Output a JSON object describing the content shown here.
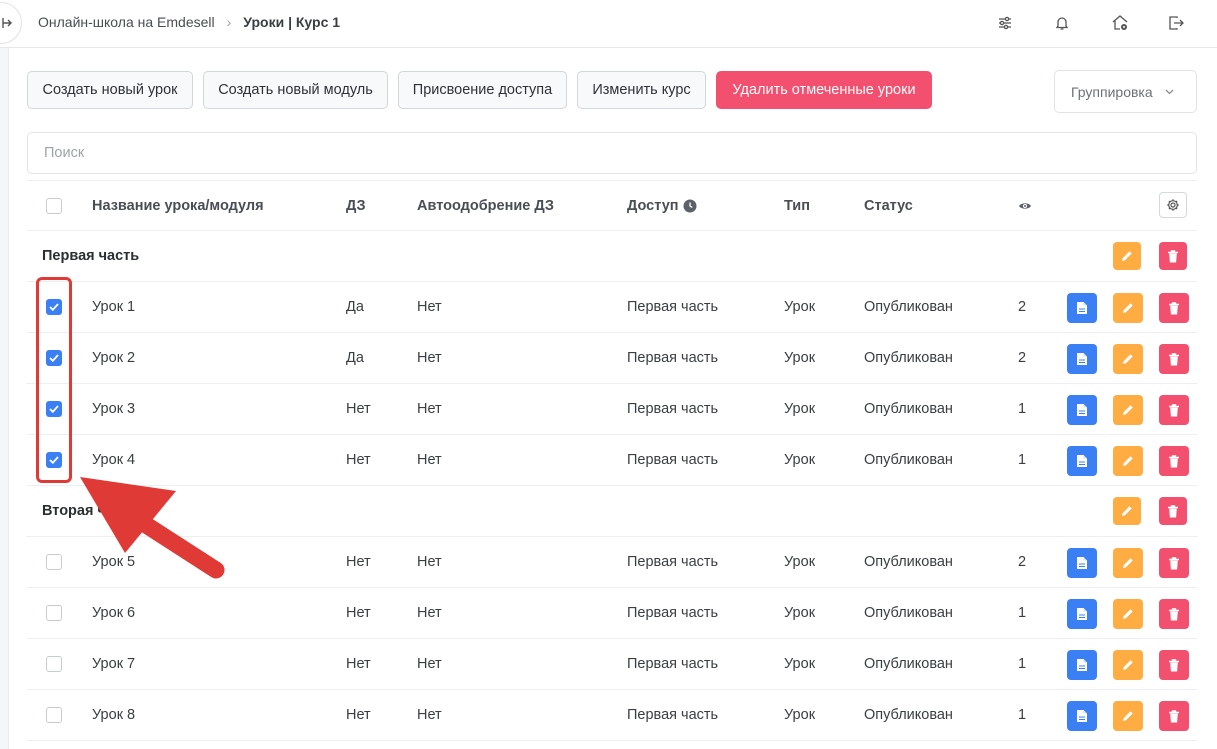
{
  "breadcrumb": {
    "school": "Онлайн-школа на Emdesell",
    "separator": "›",
    "current": "Уроки | Курс 1"
  },
  "topbar_icons": [
    "sliders-icon",
    "bell-icon",
    "home-settings-icon",
    "logout-icon"
  ],
  "toolbar": {
    "new_lesson": "Создать новый урок",
    "new_module": "Создать новый модуль",
    "assign_access": "Присвоение доступа",
    "edit_course": "Изменить курс",
    "delete_selected": "Удалить отмеченные уроки",
    "grouping": "Группировка"
  },
  "search": {
    "placeholder": "Поиск",
    "value": ""
  },
  "table": {
    "headers": {
      "name": "Название урока/модуля",
      "hw": "ДЗ",
      "auto": "Автоодобрение ДЗ",
      "access": "Доступ",
      "type": "Тип",
      "status": "Статус",
      "views_icon": "eye-icon"
    },
    "groups": [
      {
        "title": "Первая часть",
        "lessons": [
          {
            "name": "Урок 1",
            "hw": "Да",
            "auto": "Нет",
            "access": "Первая часть",
            "type": "Урок",
            "status": "Опубликован",
            "views": "2",
            "checked": true
          },
          {
            "name": "Урок 2",
            "hw": "Да",
            "auto": "Нет",
            "access": "Первая часть",
            "type": "Урок",
            "status": "Опубликован",
            "views": "2",
            "checked": true
          },
          {
            "name": "Урок 3",
            "hw": "Нет",
            "auto": "Нет",
            "access": "Первая часть",
            "type": "Урок",
            "status": "Опубликован",
            "views": "1",
            "checked": true
          },
          {
            "name": "Урок 4",
            "hw": "Нет",
            "auto": "Нет",
            "access": "Первая часть",
            "type": "Урок",
            "status": "Опубликован",
            "views": "1",
            "checked": true
          }
        ]
      },
      {
        "title": "Вторая ч",
        "lessons": [
          {
            "name": "Урок 5",
            "hw": "Нет",
            "auto": "Нет",
            "access": "Первая часть",
            "type": "Урок",
            "status": "Опубликован",
            "views": "2",
            "checked": false
          },
          {
            "name": "Урок 6",
            "hw": "Нет",
            "auto": "Нет",
            "access": "Первая часть",
            "type": "Урок",
            "status": "Опубликован",
            "views": "1",
            "checked": false
          },
          {
            "name": "Урок 7",
            "hw": "Нет",
            "auto": "Нет",
            "access": "Первая часть",
            "type": "Урок",
            "status": "Опубликован",
            "views": "1",
            "checked": false
          },
          {
            "name": "Урок 8",
            "hw": "Нет",
            "auto": "Нет",
            "access": "Первая часть",
            "type": "Урок",
            "status": "Опубликован",
            "views": "1",
            "checked": false
          }
        ]
      }
    ]
  },
  "colors": {
    "accent": "#3b7ff5",
    "edit": "#ffad42",
    "danger": "#f2506e",
    "annotation": "#e03a36"
  }
}
